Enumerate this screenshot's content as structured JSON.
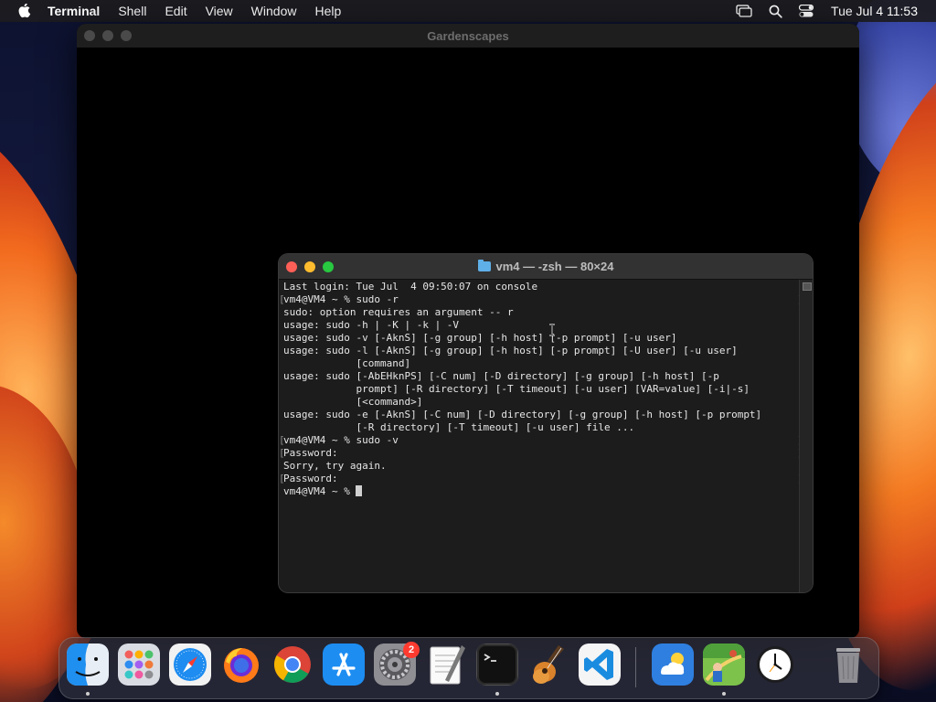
{
  "menubar": {
    "app_name": "Terminal",
    "items": [
      "Shell",
      "Edit",
      "View",
      "Window",
      "Help"
    ],
    "clock": "Tue Jul 4  11:53"
  },
  "background_window": {
    "title": "Gardenscapes"
  },
  "terminal": {
    "title": "vm4 — -zsh — 80×24",
    "lines": [
      "Last login: Tue Jul  4 09:50:07 on console",
      "vm4@VM4 ~ % sudo -r",
      "sudo: option requires an argument -- r",
      "usage: sudo -h | -K | -k | -V",
      "usage: sudo -v [-AknS] [-g group] [-h host] [-p prompt] [-u user]",
      "usage: sudo -l [-AknS] [-g group] [-h host] [-p prompt] [-U user] [-u user]",
      "            [command]",
      "usage: sudo [-AbEHknPS] [-C num] [-D directory] [-g group] [-h host] [-p",
      "            prompt] [-R directory] [-T timeout] [-u user] [VAR=value] [-i|-s]",
      "            [<command>]",
      "usage: sudo -e [-AknS] [-C num] [-D directory] [-g group] [-h host] [-p prompt]",
      "            [-R directory] [-T timeout] [-u user] file ...",
      "vm4@VM4 ~ % sudo -v",
      "Password:",
      "Sorry, try again.",
      "Password:",
      "vm4@VM4 ~ % "
    ]
  },
  "dock": {
    "apps": [
      {
        "name": "Finder",
        "icon": "finder-icon",
        "running": true
      },
      {
        "name": "Launchpad",
        "icon": "launchpad-icon",
        "running": false
      },
      {
        "name": "Safari",
        "icon": "safari-icon",
        "running": false
      },
      {
        "name": "Firefox",
        "icon": "firefox-icon",
        "running": false
      },
      {
        "name": "Chrome",
        "icon": "chrome-icon",
        "running": false
      },
      {
        "name": "App Store",
        "icon": "app-store-icon",
        "running": false
      },
      {
        "name": "System Preferences",
        "icon": "system-preferences-icon",
        "running": false,
        "badge": "2"
      },
      {
        "name": "TextEdit",
        "icon": "textedit-icon",
        "running": false
      },
      {
        "name": "Terminal",
        "icon": "terminal-icon",
        "running": true
      },
      {
        "name": "GarageBand",
        "icon": "garageband-icon",
        "running": false
      },
      {
        "name": "Visual Studio Code",
        "icon": "vscode-icon",
        "running": false
      },
      {
        "name": "Weather",
        "icon": "weather-icon",
        "running": false
      },
      {
        "name": "Gardenscapes",
        "icon": "gardenscapes-icon",
        "running": true
      },
      {
        "name": "Clock",
        "icon": "clock-icon",
        "running": false
      },
      {
        "name": "Trash",
        "icon": "trash-icon",
        "running": false
      }
    ]
  }
}
